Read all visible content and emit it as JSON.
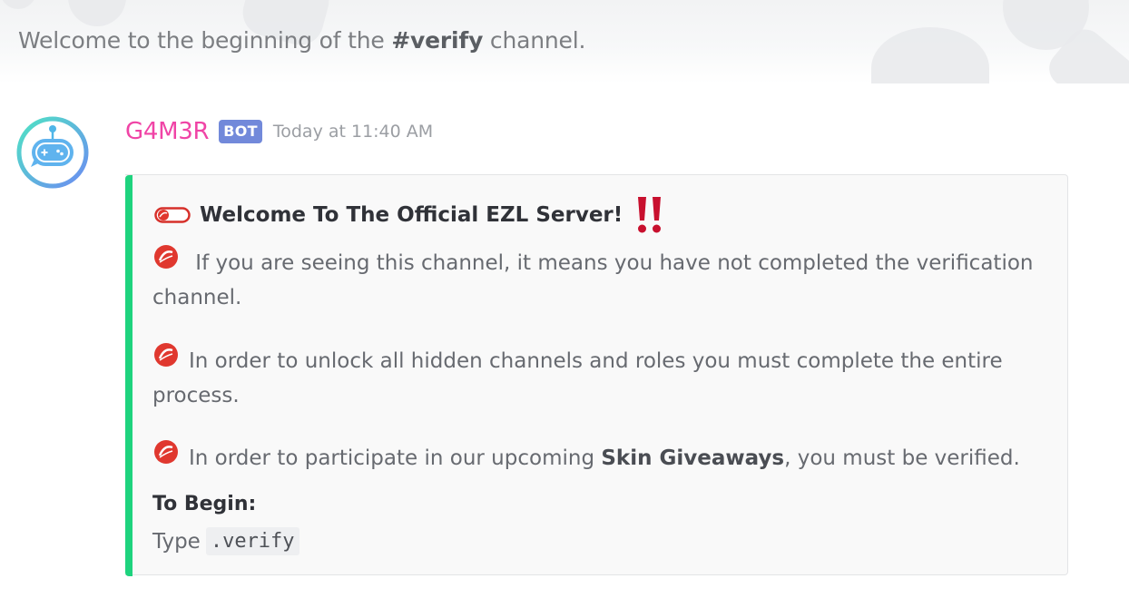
{
  "channel_header": {
    "welcome_prefix": "Welcome to the beginning of the ",
    "channel_name": "#verify",
    "welcome_suffix": " channel."
  },
  "message": {
    "author": "G4M3R",
    "bot_tag": "BOT",
    "timestamp": "Today at 11:40 AM",
    "avatar_icon": "robot-gamepad-icon",
    "author_color": "#f044a6",
    "embed": {
      "accent_color": "#1ed37e",
      "title": "Welcome To The Official EZL Server!",
      "title_icon": "toggle-switch-icon",
      "title_suffix_icon": "double-exclamation-icon",
      "bullet_icon": "red-cleat-icon",
      "paragraphs": [
        {
          "text": " If you are seeing this channel, it means you have not completed the verification channel."
        },
        {
          "text": "In order to unlock all hidden channels and roles you must complete the entire process."
        },
        {
          "text_before": "In order to participate in our upcoming ",
          "bold": "Skin Giveaways",
          "text_after": ", you must be verified."
        }
      ],
      "field": {
        "name": "To Begin:",
        "value_prefix": "Type",
        "value_code": ".verify"
      }
    }
  }
}
